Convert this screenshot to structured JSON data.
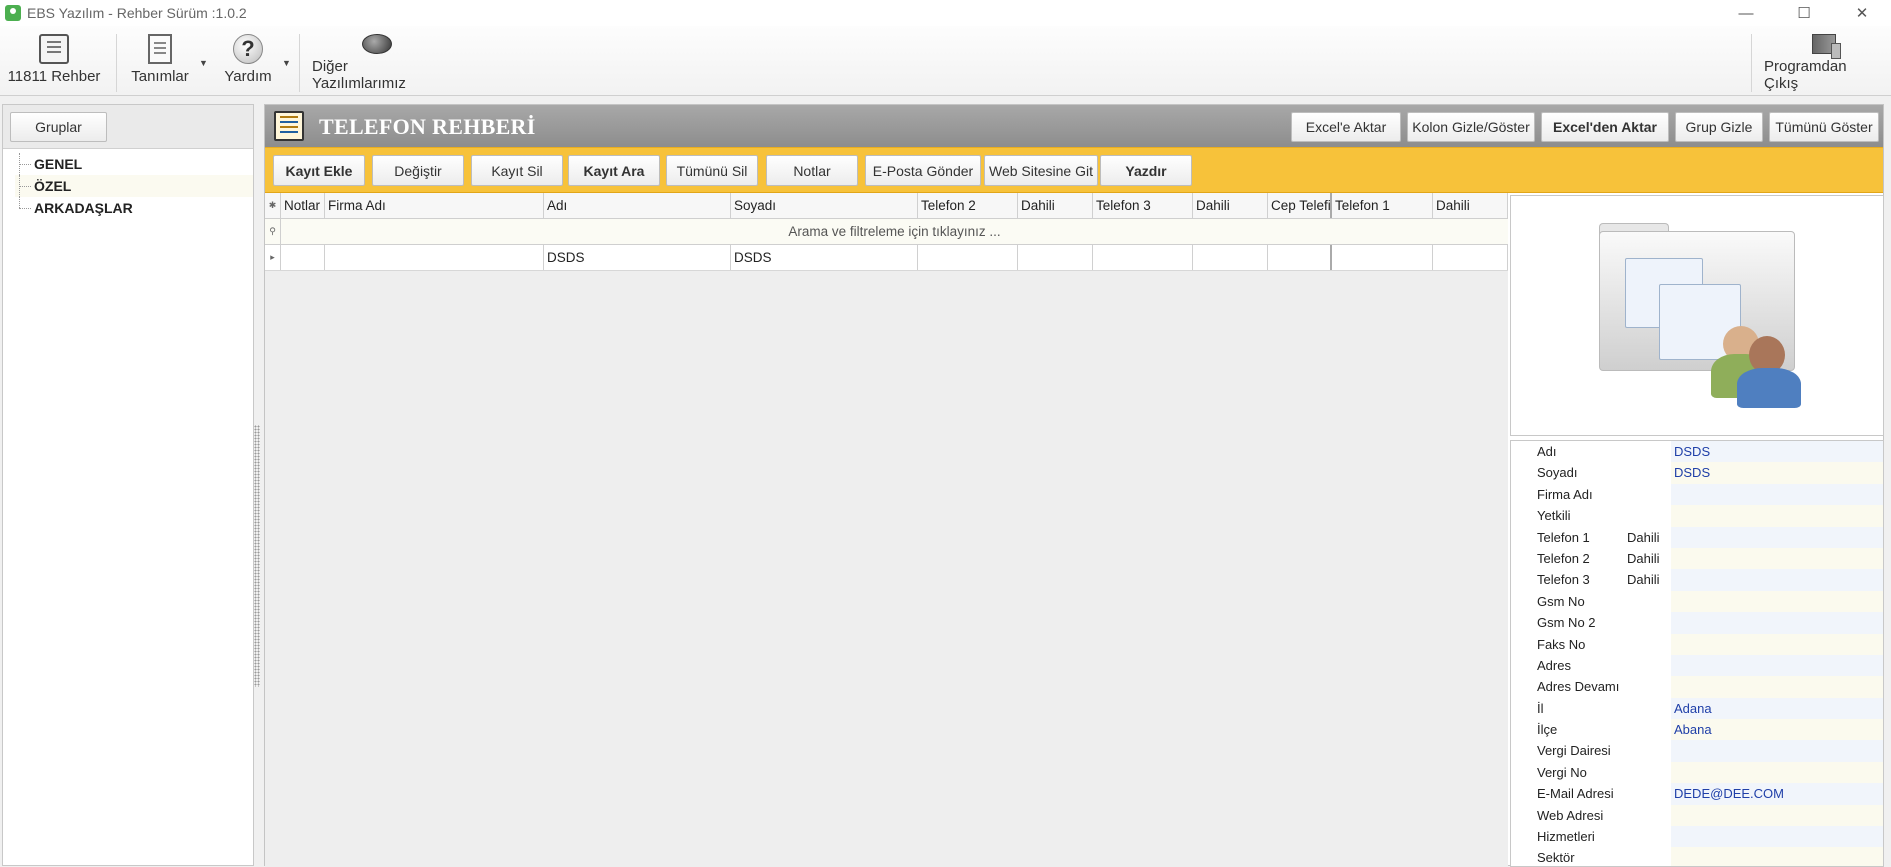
{
  "window": {
    "title": "EBS Yazılım - Rehber Sürüm :1.0.2",
    "minimize": "—",
    "maximize": "☐",
    "close": "✕"
  },
  "ribbon": {
    "rehber": "11811 Rehber",
    "tanimlar": "Tanımlar",
    "yardim": "Yardım",
    "diger": "Diğer Yazılımlarımız",
    "cikis": "Programdan Çıkış",
    "dropdown_glyph": "▼",
    "help_glyph": "?"
  },
  "left": {
    "gruplar_button": "Gruplar",
    "groups": [
      "GENEL",
      "ÖZEL",
      "ARKADAŞLAR"
    ]
  },
  "main": {
    "title": "TELEFON REHBERİ",
    "header_buttons": [
      "Excel'e Aktar",
      "Kolon Gizle/Göster",
      "Excel'den Aktar",
      "Grup Gizle",
      "Tümünü Göster"
    ],
    "toolbar": [
      "Kayıt Ekle",
      "Değiştir",
      "Kayıt Sil",
      "Kayıt Ara",
      "Tümünü Sil",
      "Notlar",
      "E-Posta Gönder",
      "Web Sitesine Git",
      "Yazdır"
    ],
    "columns": [
      "Notlar",
      "Firma Adı",
      "Adı",
      "Soyadı",
      "Telefon 2",
      "Dahili",
      "Telefon 3",
      "Dahili",
      "Cep Telefi",
      "Telefon 1",
      "Dahili"
    ],
    "filter_placeholder": "Arama ve filtreleme  için tıklayınız ...",
    "row_indicator": "▸",
    "header_indicator": "✱",
    "filter_indicator": "⚲",
    "rows": [
      [
        "",
        "",
        "DSDS",
        "DSDS",
        "",
        "",
        "",
        "",
        "",
        "",
        ""
      ]
    ]
  },
  "details": [
    {
      "label": "Adı",
      "sub": "",
      "value": "DSDS"
    },
    {
      "label": "Soyadı",
      "sub": "",
      "value": "DSDS"
    },
    {
      "label": "Firma Adı",
      "sub": "",
      "value": ""
    },
    {
      "label": "Yetkili",
      "sub": "",
      "value": ""
    },
    {
      "label": "Telefon 1",
      "sub": "Dahili",
      "value": ""
    },
    {
      "label": "Telefon 2",
      "sub": "Dahili",
      "value": ""
    },
    {
      "label": "Telefon 3",
      "sub": "Dahili",
      "value": ""
    },
    {
      "label": "Gsm No",
      "sub": "",
      "value": ""
    },
    {
      "label": "Gsm No 2",
      "sub": "",
      "value": ""
    },
    {
      "label": "Faks No",
      "sub": "",
      "value": ""
    },
    {
      "label": "Adres",
      "sub": "",
      "value": ""
    },
    {
      "label": "Adres Devamı",
      "sub": "",
      "value": ""
    },
    {
      "label": "İl",
      "sub": "",
      "value": "Adana"
    },
    {
      "label": "İlçe",
      "sub": "",
      "value": "Abana"
    },
    {
      "label": "Vergi Dairesi",
      "sub": "",
      "value": ""
    },
    {
      "label": "Vergi No",
      "sub": "",
      "value": ""
    },
    {
      "label": "E-Mail Adresi",
      "sub": "",
      "value": "DEDE@DEE.COM"
    },
    {
      "label": "Web Adresi",
      "sub": "",
      "value": ""
    },
    {
      "label": "Hizmetleri",
      "sub": "",
      "value": ""
    },
    {
      "label": "Sektör",
      "sub": "",
      "value": ""
    }
  ],
  "colors": {
    "toolbar_yellow": "#f7c23a",
    "header_gray": "#9a9a9a",
    "value_blue": "#1f3fa8"
  }
}
